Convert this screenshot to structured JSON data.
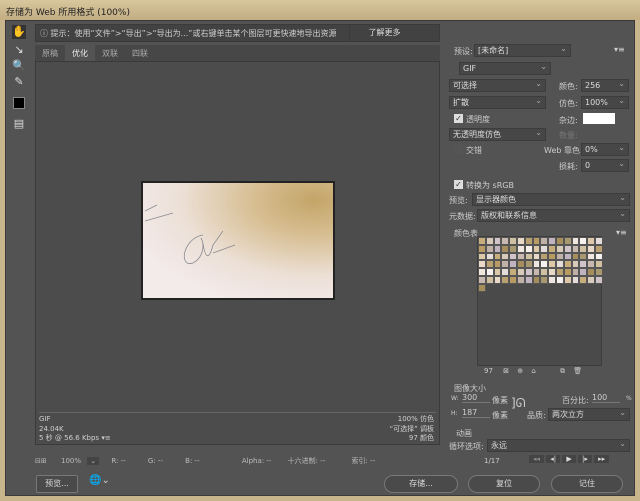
{
  "title": "存储为 Web 所用格式 (100%)",
  "infobar": {
    "text": "提示：使用“文件”>“导出”>“导出为...”或右键单击某个图层可更快速地导出资源",
    "learn_more": "了解更多"
  },
  "tabs": [
    {
      "label": "原稿"
    },
    {
      "label": "优化",
      "active": true
    },
    {
      "label": "双联"
    },
    {
      "label": "四联"
    }
  ],
  "preview_info": {
    "format": "GIF",
    "size": "24.04K",
    "time": "5 秒 @ 56.6 Kbps",
    "dither": "100% 仿色",
    "palette": "“可选择” 调板",
    "colors": "97 颜色"
  },
  "bottombar": {
    "zoom": "100%",
    "r": "R: --",
    "g": "G: --",
    "b": "B: --",
    "alpha": "Alpha: --",
    "hex": "十六进制: --",
    "index": "索引: --"
  },
  "buttons": {
    "preview": "预览...",
    "save": "存储...",
    "reset": "复位",
    "remember": "记住"
  },
  "settings": {
    "preset_label": "预设:",
    "preset": "[未命名]",
    "format": "GIF",
    "reduction": "可选择",
    "colors_label": "颜色:",
    "colors": "256",
    "dither_algo": "扩散",
    "dither_label": "仿色:",
    "dither": "100%",
    "transparency_label": "透明度",
    "transparency": true,
    "matte_label": "杂边:",
    "matte_color": "#ffffff",
    "trans_dither": "无透明度仿色",
    "amount_label": "数量:",
    "interlaced_label": "交错",
    "interlaced": false,
    "websnap_label": "Web 靠色:",
    "websnap": "0%",
    "lossy_label": "损耗:",
    "lossy": "0",
    "srgb_label": "转换为 sRGB",
    "srgb": true,
    "preview_label": "预览:",
    "preview_mode": "显示器颜色",
    "metadata_label": "元数据:",
    "metadata": "版权和联系信息"
  },
  "color_table": {
    "label": "颜色表",
    "count": "97",
    "palette": [
      "#c7ad7c",
      "#b89a62",
      "#dcc8a8",
      "#e8d8c8",
      "#f0e6e0",
      "#c9b8b0",
      "#a68e5c",
      "#d8cab8",
      "#bfb0a8",
      "#e4dcd8",
      "#b8a070",
      "#f6f0ee",
      "#cec0a0",
      "#a89870",
      "#d0c4c8",
      "#c0b4c0"
    ]
  },
  "image_size": {
    "label": "图像大小",
    "w_label": "W:",
    "width": "300",
    "h_label": "H:",
    "height": "187",
    "unit": "像素",
    "percent_label": "百分比:",
    "percent": "100",
    "percent_unit": "%",
    "quality_label": "品质:",
    "quality": "两次立方"
  },
  "animation": {
    "label": "动画",
    "loop_label": "循环选项:",
    "loop": "永远",
    "frame": "1/17"
  }
}
